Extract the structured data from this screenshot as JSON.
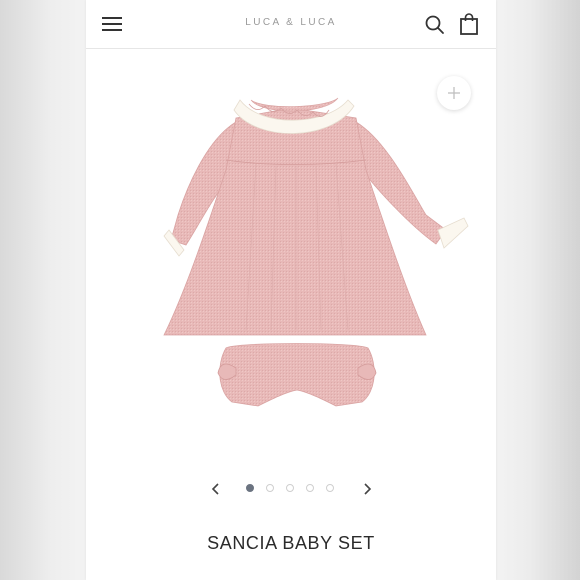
{
  "header": {
    "brand": "LUCA & LUCA",
    "menu_icon": "hamburger-menu-icon",
    "search_icon": "search-icon",
    "bag_icon": "shopping-bag-icon"
  },
  "gallery": {
    "zoom_icon": "plus-icon",
    "prev_icon": "chevron-left-icon",
    "next_icon": "chevron-right-icon",
    "dot_count": 5,
    "active_index": 0,
    "image_colors": {
      "dress": "#e8b9b8",
      "trim": "#fbf7ef"
    }
  },
  "product": {
    "title": "SANCIA BABY SET"
  }
}
